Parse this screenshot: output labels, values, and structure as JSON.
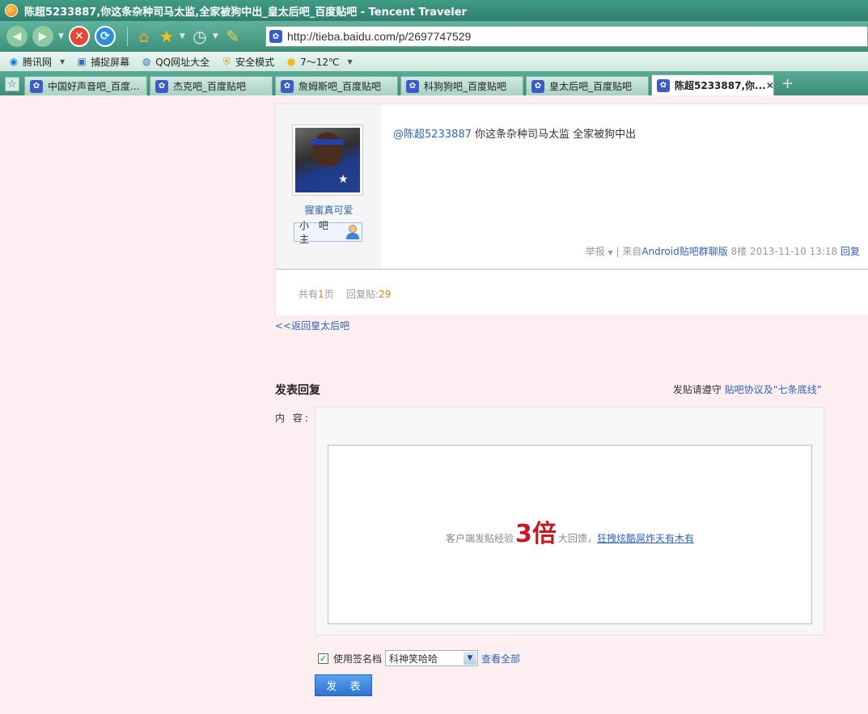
{
  "window": {
    "title": "陈超5233887,你这条杂种司马太监,全家被狗中出_皇太后吧_百度贴吧 - Tencent Traveler"
  },
  "address": {
    "url": "http://tieba.baidu.com/p/2697747529"
  },
  "bookmarks": [
    {
      "label": "腾讯网",
      "icon": "qq-icon"
    },
    {
      "label": "捕捉屏幕",
      "icon": "screenshot-icon"
    },
    {
      "label": "QQ网址大全",
      "icon": "qq-sites-icon"
    },
    {
      "label": "安全模式",
      "icon": "shield-icon"
    },
    {
      "label": "7～12℃",
      "icon": "weather-sun-icon"
    }
  ],
  "tabs": [
    {
      "label": "中国好声音吧_百度..."
    },
    {
      "label": "杰克吧_百度贴吧"
    },
    {
      "label": "詹姆斯吧_百度贴吧"
    },
    {
      "label": "科狗狗吧_百度贴吧"
    },
    {
      "label": "皇太后吧_百度贴吧"
    },
    {
      "label": "陈超5233887,你..."
    }
  ],
  "post": {
    "author": "猩蜜真可爱",
    "badge": "小 吧 主",
    "mention": "@陈超5233887",
    "text": " 你这条杂种司马太监 全家被狗中出",
    "meta_report": "举报",
    "meta_source_prefix": "| 来自",
    "meta_source": "Android贴吧群聊版",
    "meta_floor": "8楼",
    "meta_time": "2013-11-10 13:18",
    "meta_reply": "回复"
  },
  "pagination": {
    "prefix": "共有",
    "pages": "1",
    "pages_suffix": "页",
    "reply_label": "回复贴:",
    "reply_count": "29"
  },
  "back_link": "<<返回皇太后吧",
  "reply_form": {
    "title": "发表回复",
    "rules_prefix": "发贴请遵守 ",
    "rules_link": "贴吧协议及“七条底线”",
    "content_label": "内 容:",
    "promo_before": "客户端发贴经验",
    "promo_big": "3倍",
    "promo_after": "大回馈，",
    "promo_link": "狂拽炫酷屌炸天有木有",
    "sign_checkbox_label": "使用签名档",
    "sign_selected": "科神笑哈哈",
    "sign_view_all": "查看全部",
    "submit": "发 表"
  }
}
